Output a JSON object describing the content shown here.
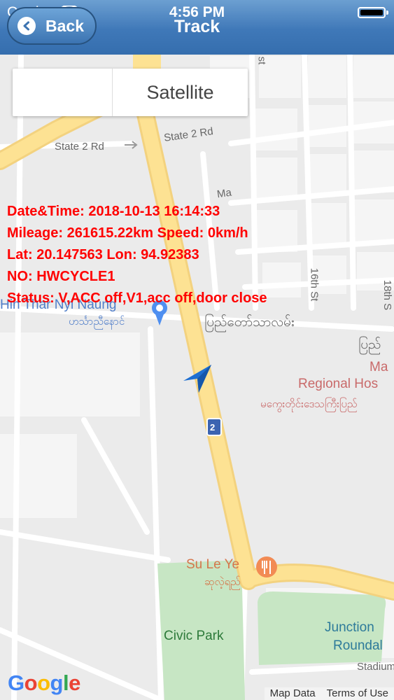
{
  "status_bar": {
    "carrier": "Carrier",
    "time": "4:56 PM"
  },
  "nav": {
    "back_label": "Back",
    "title": "Track",
    "color": "#3f78b8"
  },
  "map_type": {
    "satellite_label": "Satellite"
  },
  "info": {
    "datetime": "Date&Time: 2018-10-13 16:14:33",
    "mileage_speed": "Mileage: 261615.22km   Speed: 0km/h",
    "lat_lon": "Lat: 20.147563  Lon: 94.92383",
    "number": "NO: HWCYCLE1",
    "status": "Status: V,ACC off,V1,acc off,door close",
    "color": "#ff0000"
  },
  "map_labels": {
    "state_2_rd_a": "State 2 Rd",
    "state_2_rd_b": "State 2 Rd",
    "hin_thar": "Hin Thar Nyi Naung",
    "hin_thar_my": "ဟင်္သာညီနောင်",
    "pyi_taw_thar": "ပြည်တော်သာလမ်း",
    "pyi_short": "ပြည်",
    "regional_hos": "Regional Hos",
    "ma": "Ma",
    "regional_my": "မကွေးတိုင်းဒေသကြီးပြည်",
    "su_le_ye": "Su Le Ye",
    "su_le_ye_my": "ဆုလဲ့ရည်",
    "civic_park": "Civic Park",
    "junction": "Junction",
    "roundabout": "Roundal",
    "stadium": "Stadium",
    "st_a": "st",
    "st_b": "16th St",
    "st_c": "18th S",
    "ma_st": "Ma"
  },
  "route_shield": "2",
  "footer": {
    "google": "Google",
    "map_data": "Map Data",
    "terms": "Terms of Use"
  }
}
